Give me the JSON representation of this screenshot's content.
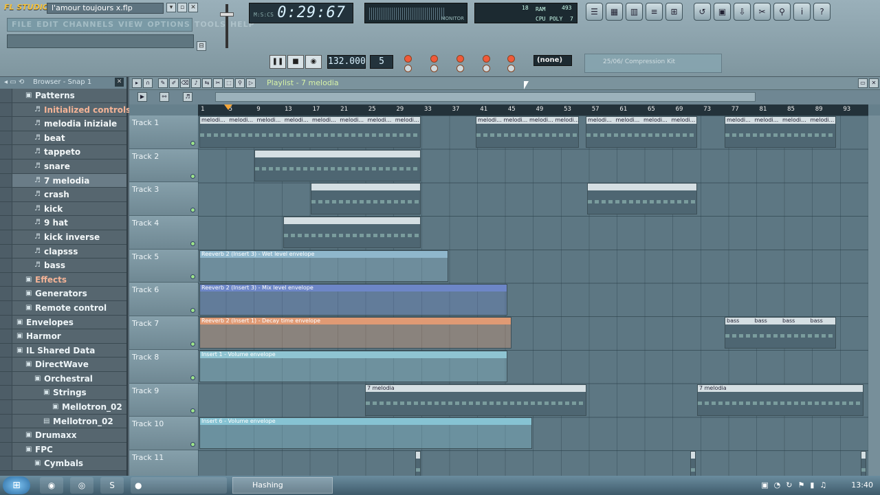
{
  "app": {
    "logo": "FL STUDIO",
    "project_title": "l'amour toujours x.flp",
    "menus": [
      "FILE",
      "EDIT",
      "CHANNELS",
      "VIEW",
      "OPTIONS",
      "TOOLS",
      "HELP"
    ]
  },
  "transport": {
    "time": "0:29:67",
    "time_prefix": "M:S:CS",
    "tempo": "132.000",
    "pattern_number": "5",
    "snap": "(none)",
    "hint_preset": "25/06/ Compression Kit",
    "monitor_label": "MONITOR",
    "cpu_labels": {
      "cpu": "CPU",
      "poly": "POLY",
      "ram": "RAM",
      "cpu_val": "18",
      "ram_val": "493",
      "poly_val": "7"
    }
  },
  "browser": {
    "title": "Browser - Snap 1",
    "items": [
      {
        "label": "Patterns",
        "kind": "folder",
        "indent": 1
      },
      {
        "label": "Initialized controls",
        "kind": "pattern",
        "indent": 2,
        "style": "red"
      },
      {
        "label": "melodia iniziale",
        "kind": "pattern",
        "indent": 2
      },
      {
        "label": "beat",
        "kind": "pattern",
        "indent": 2
      },
      {
        "label": "tappeto",
        "kind": "pattern",
        "indent": 2
      },
      {
        "label": "snare",
        "kind": "pattern",
        "indent": 2
      },
      {
        "label": "7 melodia",
        "kind": "pattern",
        "indent": 2,
        "selected": true
      },
      {
        "label": "crash",
        "kind": "pattern",
        "indent": 2
      },
      {
        "label": "kick",
        "kind": "pattern",
        "indent": 2
      },
      {
        "label": "9 hat",
        "kind": "pattern",
        "indent": 2
      },
      {
        "label": "kick inverse",
        "kind": "pattern",
        "indent": 2
      },
      {
        "label": "clapsss",
        "kind": "pattern",
        "indent": 2
      },
      {
        "label": "bass",
        "kind": "pattern",
        "indent": 2
      },
      {
        "label": "Effects",
        "kind": "folder",
        "indent": 1,
        "style": "red"
      },
      {
        "label": "Generators",
        "kind": "folder",
        "indent": 1
      },
      {
        "label": "Remote control",
        "kind": "folder",
        "indent": 1
      },
      {
        "label": "Envelopes",
        "kind": "folder",
        "indent": 0
      },
      {
        "label": "Harmor",
        "kind": "folder",
        "indent": 0
      },
      {
        "label": "IL Shared Data",
        "kind": "folder",
        "indent": 0
      },
      {
        "label": "DirectWave",
        "kind": "folder",
        "indent": 1
      },
      {
        "label": "Orchestral",
        "kind": "folder",
        "indent": 2
      },
      {
        "label": "Strings",
        "kind": "folder",
        "indent": 3
      },
      {
        "label": "Mellotron_02",
        "kind": "folder",
        "indent": 4
      },
      {
        "label": "Mellotron_02",
        "kind": "file",
        "indent": 3
      },
      {
        "label": "Drumaxx",
        "kind": "folder",
        "indent": 1
      },
      {
        "label": "FPC",
        "kind": "folder",
        "indent": 1
      },
      {
        "label": "Cymbals",
        "kind": "folder",
        "indent": 2
      }
    ]
  },
  "playlist": {
    "title": "Playlist - 7 melodia",
    "ruler": [
      "1",
      "5",
      "9",
      "13",
      "17",
      "21",
      "25",
      "29",
      "33",
      "37",
      "41",
      "45",
      "49",
      "53",
      "57",
      "61",
      "65",
      "69",
      "73",
      "77",
      "81",
      "85",
      "89",
      "93"
    ],
    "tracks": [
      "Track 1",
      "Track 2",
      "Track 3",
      "Track 4",
      "Track 5",
      "Track 6",
      "Track 7",
      "Track 8",
      "Track 9",
      "Track 10",
      "Track 11"
    ],
    "clip_labels": {
      "melodia": "melodi...",
      "reverb_wet": "Reeverb 2 (Insert 3) - Wet level envelope",
      "reverb_mix": "Reeverb 2 (Insert 3) - Mix level envelope",
      "reverb_decay": "Reeverb 2 (Insert 1) - Decay time envelope",
      "insert1_vol": "Insert 1 - Volume envelope",
      "melodia7": "7 melodia",
      "insert6_vol": "Insert 6 - Volume envelope",
      "bass": "bass"
    },
    "colors": {
      "wet": "#8fb7cc",
      "mix": "#6d86c7",
      "decay": "#e09a74",
      "insert1": "#8fc4d2",
      "insert6": "#86c3d3"
    }
  },
  "taskbar": {
    "task_label": "Hashing",
    "clock": "13:40"
  }
}
